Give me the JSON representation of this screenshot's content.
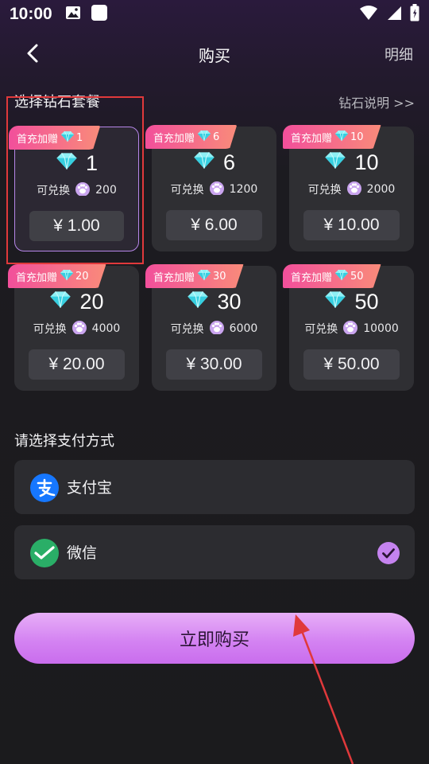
{
  "status_bar": {
    "time": "10:00"
  },
  "nav": {
    "title": "购买",
    "detail_link": "明细"
  },
  "packages_section": {
    "heading": "选择钻石套餐",
    "info_link": "钻石说明 >>",
    "packages": [
      {
        "badge": "首充加赠",
        "bonus": "1",
        "diamonds": "1",
        "exchange_label": "可兑换",
        "exchange_amount": "200",
        "price": "¥ 1.00",
        "selected": true
      },
      {
        "badge": "首充加赠",
        "bonus": "6",
        "diamonds": "6",
        "exchange_label": "可兑换",
        "exchange_amount": "1200",
        "price": "¥ 6.00",
        "selected": false
      },
      {
        "badge": "首充加赠",
        "bonus": "10",
        "diamonds": "10",
        "exchange_label": "可兑换",
        "exchange_amount": "2000",
        "price": "¥ 10.00",
        "selected": false
      },
      {
        "badge": "首充加赠",
        "bonus": "20",
        "diamonds": "20",
        "exchange_label": "可兑换",
        "exchange_amount": "4000",
        "price": "¥ 20.00",
        "selected": false
      },
      {
        "badge": "首充加赠",
        "bonus": "30",
        "diamonds": "30",
        "exchange_label": "可兑换",
        "exchange_amount": "6000",
        "price": "¥ 30.00",
        "selected": false
      },
      {
        "badge": "首充加赠",
        "bonus": "50",
        "diamonds": "50",
        "exchange_label": "可兑换",
        "exchange_amount": "10000",
        "price": "¥ 50.00",
        "selected": false
      }
    ]
  },
  "payment": {
    "heading": "请选择支付方式",
    "methods": [
      {
        "label": "支付宝",
        "icon": "alipay-icon",
        "selected": false
      },
      {
        "label": "微信",
        "icon": "wechat-icon",
        "selected": true
      }
    ]
  },
  "buy_button": {
    "label": "立即购买"
  },
  "colors": {
    "accent": "#d483f2",
    "badge_gradient_start": "#f24f9b",
    "badge_gradient_end": "#f98b7a",
    "diamond": "#4fd9e6",
    "annotation": "#e0393b"
  }
}
